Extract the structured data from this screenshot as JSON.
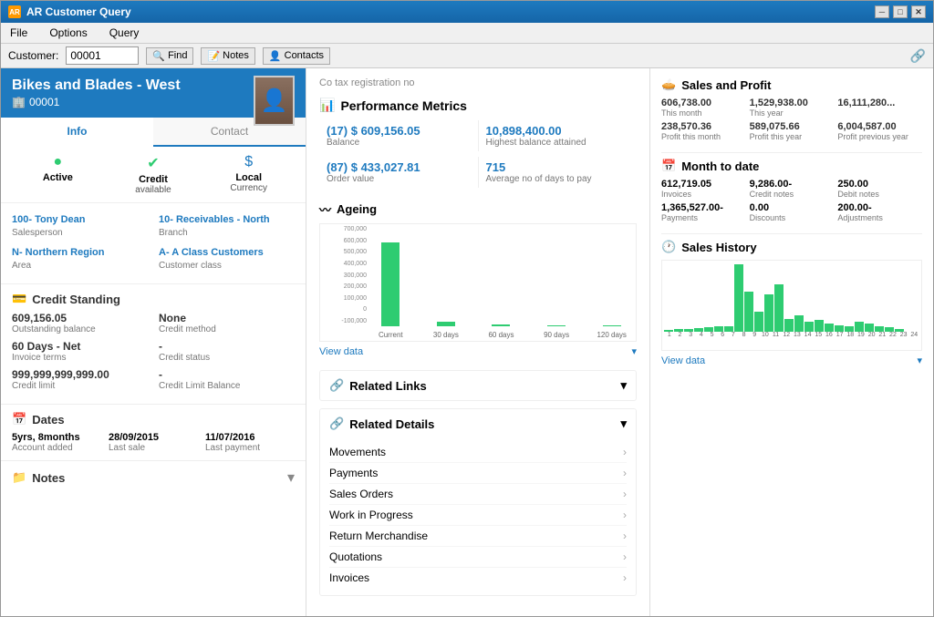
{
  "window": {
    "title": "AR Customer Query"
  },
  "menu": {
    "items": [
      "File",
      "Options",
      "Query"
    ]
  },
  "toolbar": {
    "customer_label": "Customer:",
    "customer_value": "00001",
    "find_label": "Find",
    "notes_label": "Notes",
    "contacts_label": "Contacts"
  },
  "customer": {
    "name": "Bikes and Blades - West",
    "id": "00001",
    "tax_reg": "Co tax registration no"
  },
  "tabs": {
    "info": "Info",
    "contact": "Contact"
  },
  "status": {
    "active_label": "Active",
    "credit_label": "Credit",
    "credit_sub": "available",
    "currency_label": "Local",
    "currency_sub": "Currency"
  },
  "info_fields": {
    "salesperson_value": "100- Tony Dean",
    "salesperson_label": "Salesperson",
    "branch_value": "10- Receivables - North",
    "branch_label": "Branch",
    "area_value": "N- Northern Region",
    "area_label": "Area",
    "class_value": "A- A Class Customers",
    "class_label": "Customer class"
  },
  "credit_standing": {
    "title": "Credit Standing",
    "outstanding_value": "609,156.05",
    "outstanding_label": "Outstanding balance",
    "credit_method_value": "None",
    "credit_method_label": "Credit method",
    "invoice_terms_value": "60 Days - Net",
    "invoice_terms_label": "Invoice terms",
    "credit_status_value": "-",
    "credit_status_label": "Credit status",
    "credit_limit_value": "999,999,999,999.00",
    "credit_limit_label": "Credit limit",
    "credit_limit_balance_value": "-",
    "credit_limit_balance_label": "Credit Limit Balance"
  },
  "dates": {
    "title": "Dates",
    "account_age": "5yrs, 8months",
    "account_age_label": "Account added",
    "last_sale": "28/09/2015",
    "last_sale_label": "Last sale",
    "last_payment": "11/07/2016",
    "last_payment_label": "Last payment"
  },
  "notes": {
    "title": "Notes"
  },
  "performance": {
    "title": "Performance Metrics",
    "balance_value": "(17) $ 609,156.05",
    "balance_label": "Balance",
    "highest_value": "10,898,400.00",
    "highest_label": "Highest balance attained",
    "order_value": "(87) $ 433,027.81",
    "order_label": "Order value",
    "avg_days_value": "715",
    "avg_days_label": "Average no of days to pay"
  },
  "ageing": {
    "title": "Ageing",
    "y_axis": [
      "700,000",
      "600,000",
      "500,000",
      "400,000",
      "300,000",
      "200,000",
      "100,000",
      "0",
      "-100,000"
    ],
    "bars": [
      {
        "label": "Current",
        "height": 85,
        "value": 620000,
        "negative": false
      },
      {
        "label": "30 days",
        "height": 5,
        "value": 40000,
        "negative": false
      },
      {
        "label": "60 days",
        "height": 2,
        "value": 10000,
        "negative": false
      },
      {
        "label": "90 days",
        "height": 1,
        "value": 5000,
        "negative": false
      },
      {
        "label": "120 days",
        "height": 1,
        "value": 3000,
        "negative": false
      }
    ],
    "view_data": "View data"
  },
  "related_links": {
    "title": "Related Links",
    "chevron": "▾"
  },
  "related_details": {
    "title": "Related Details",
    "chevron": "▾",
    "items": [
      "Movements",
      "Payments",
      "Sales Orders",
      "Work in Progress",
      "Return Merchandise",
      "Quotations",
      "Invoices"
    ]
  },
  "sales_profit": {
    "title": "Sales and Profit",
    "items": [
      {
        "value": "606,738.00",
        "label": "This month"
      },
      {
        "value": "1,529,938.00",
        "label": "This year"
      },
      {
        "value": "16,111,280...",
        "label": ""
      },
      {
        "value": "238,570.36",
        "label": "Profit this month"
      },
      {
        "value": "589,075.66",
        "label": "Profit this year"
      },
      {
        "value": "6,004,587.00",
        "label": "Profit previous year"
      }
    ]
  },
  "month_to_date": {
    "title": "Month to date",
    "items": [
      {
        "value": "612,719.05",
        "label": "Invoices"
      },
      {
        "value": "9,286.00-",
        "label": "Credit notes"
      },
      {
        "value": "250.00",
        "label": "Debit notes"
      },
      {
        "value": "1,365,527.00-",
        "label": "Payments"
      },
      {
        "value": "0.00",
        "label": "Discounts"
      },
      {
        "value": "200.00-",
        "label": "Adjustments"
      }
    ]
  },
  "sales_history": {
    "title": "Sales History",
    "view_data": "View data",
    "bars": [
      3,
      5,
      4,
      6,
      7,
      8,
      9,
      100,
      60,
      30,
      55,
      70,
      20,
      25,
      15,
      18,
      12,
      10,
      8,
      15,
      12,
      9,
      7,
      5
    ],
    "x_labels": [
      "1",
      "2",
      "3",
      "4",
      "5",
      "6",
      "7",
      "8",
      "9",
      "10",
      "11",
      "12",
      "13",
      "14",
      "15",
      "16",
      "17",
      "18",
      "19",
      "20",
      "21",
      "22",
      "23",
      "24"
    ]
  }
}
